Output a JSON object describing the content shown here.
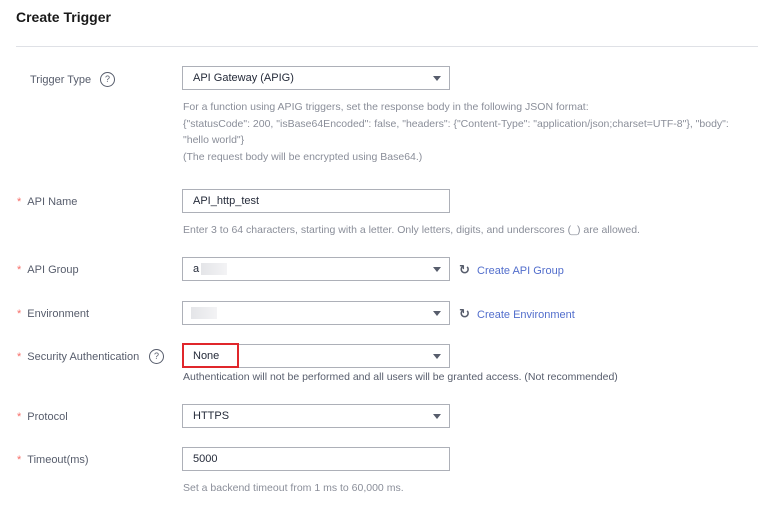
{
  "page": {
    "title": "Create Trigger"
  },
  "trigger_type": {
    "label": "Trigger Type",
    "help": "?",
    "value": "API Gateway (APIG)",
    "hint_lines": [
      "For a function using APIG triggers, set the response body in the following JSON format:",
      "{\"statusCode\": 200, \"isBase64Encoded\": false, \"headers\": {\"Content-Type\": \"application/json;charset=UTF-8\"}, \"body\":",
      "\"hello world\"}",
      "(The request body will be encrypted using Base64.)"
    ]
  },
  "api_name": {
    "required": "*",
    "label": "API Name",
    "value": "API_http_test",
    "hint": "Enter 3 to 64 characters, starting with a letter. Only letters, digits, and underscores (_) are allowed."
  },
  "api_group": {
    "required": "*",
    "label": "API Group",
    "value": "a",
    "link": "Create API Group"
  },
  "environment": {
    "required": "*",
    "label": "Environment",
    "value": "",
    "link": "Create Environment"
  },
  "security_auth": {
    "required": "*",
    "label": "Security Authentication",
    "help": "?",
    "value": "None",
    "hint": "Authentication will not be performed and all users will be granted access. (Not recommended)"
  },
  "protocol": {
    "required": "*",
    "label": "Protocol",
    "value": "HTTPS"
  },
  "timeout": {
    "required": "*",
    "label": "Timeout(ms)",
    "value": "5000",
    "hint": "Set a backend timeout from 1 ms to 60,000 ms."
  },
  "icons": {
    "refresh": "↻",
    "help": "question-circle-icon",
    "dropdown": "caret-down-icon"
  },
  "colors": {
    "required": "#f66f6a",
    "link": "#526ecc",
    "highlight_box": "#e0262b"
  }
}
